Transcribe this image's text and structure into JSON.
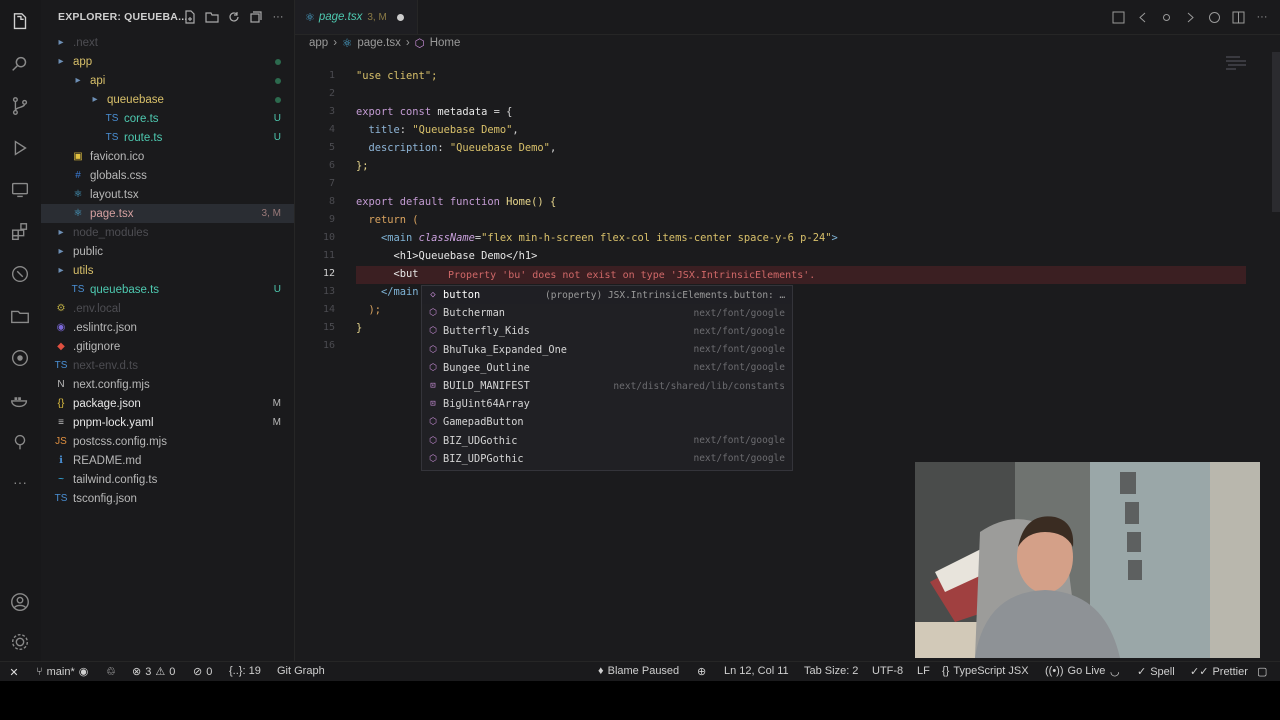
{
  "explorer": {
    "title": "EXPLORER: QUEUEBA...",
    "items": [
      {
        "label": ".next",
        "type": "folder",
        "status": ""
      },
      {
        "label": "app",
        "type": "folder",
        "status": ""
      },
      {
        "label": "api",
        "type": "folder",
        "status": ""
      },
      {
        "label": "queuebase",
        "type": "folder",
        "status": ""
      },
      {
        "label": "core.ts",
        "type": "ts",
        "status": "U"
      },
      {
        "label": "route.ts",
        "type": "ts",
        "status": "U"
      },
      {
        "label": "favicon.ico",
        "type": "ico",
        "status": ""
      },
      {
        "label": "globals.css",
        "type": "css",
        "status": ""
      },
      {
        "label": "layout.tsx",
        "type": "tsx",
        "status": ""
      },
      {
        "label": "page.tsx",
        "type": "tsx",
        "status": "3, M"
      },
      {
        "label": "node_modules",
        "type": "folder",
        "status": ""
      },
      {
        "label": "public",
        "type": "folder",
        "status": ""
      },
      {
        "label": "utils",
        "type": "folder",
        "status": ""
      },
      {
        "label": "queuebase.ts",
        "type": "ts",
        "status": "U"
      },
      {
        "label": ".env.local",
        "type": "env",
        "status": ""
      },
      {
        "label": ".eslintrc.json",
        "type": "eslint",
        "status": ""
      },
      {
        "label": ".gitignore",
        "type": "git",
        "status": ""
      },
      {
        "label": "next-env.d.ts",
        "type": "ts",
        "status": ""
      },
      {
        "label": "next.config.mjs",
        "type": "next",
        "status": ""
      },
      {
        "label": "package.json",
        "type": "json",
        "status": "M"
      },
      {
        "label": "pnpm-lock.yaml",
        "type": "yaml",
        "status": "M"
      },
      {
        "label": "postcss.config.mjs",
        "type": "js",
        "status": ""
      },
      {
        "label": "README.md",
        "type": "md",
        "status": ""
      },
      {
        "label": "tailwind.config.ts",
        "type": "tw",
        "status": ""
      },
      {
        "label": "tsconfig.json",
        "type": "tsjson",
        "status": ""
      }
    ]
  },
  "tab": {
    "name": "page.tsx",
    "status": "3, M"
  },
  "breadcrumb": [
    "app",
    "page.tsx",
    "Home"
  ],
  "editor": {
    "line_numbers": [
      "1",
      "2",
      "3",
      "4",
      "5",
      "6",
      "7",
      "8",
      "9",
      "10",
      "11",
      "12",
      "13",
      "14",
      "15",
      "16"
    ],
    "current_line": "12",
    "lines": {
      "l1": "\"use client\";",
      "l3_kw": "export const ",
      "l3_name": "metadata",
      "l3_rest": " = {",
      "l4_prop": "  title",
      "l4_str": "\"Queuebase Demo\"",
      "l5_prop": "  description",
      "l5_str": "\"Queuebase Demo\"",
      "l6": "};",
      "l8_kw": "export default function ",
      "l8_fn": "Home",
      "l8_rest": "() {",
      "l9": "  return (",
      "l10_open": "    <main ",
      "l10_attr": "className",
      "l10_val": "\"flex min-h-screen flex-col items-center space-y-6 p-24\"",
      "l10_close": ">",
      "l11": "      <h1>Queuebase Demo</h1>",
      "l12": "      <but",
      "l13": "    </main",
      "l14": "  );",
      "l15": "}"
    },
    "error_message": "Property 'bu' does not exist on type 'JSX.IntrinsicElements'."
  },
  "suggestions": [
    {
      "label": "button",
      "detail": "(property) JSX.IntrinsicElements.button: …",
      "icon": "property"
    },
    {
      "label": "Butcherman",
      "detail": "next/font/google",
      "icon": "module"
    },
    {
      "label": "Butterfly_Kids",
      "detail": "next/font/google",
      "icon": "module"
    },
    {
      "label": "BhuTuka_Expanded_One",
      "detail": "next/font/google",
      "icon": "module"
    },
    {
      "label": "Bungee_Outline",
      "detail": "next/font/google",
      "icon": "module"
    },
    {
      "label": "BUILD_MANIFEST",
      "detail": "next/dist/shared/lib/constants",
      "icon": "variable"
    },
    {
      "label": "BigUint64Array",
      "detail": "",
      "icon": "variable"
    },
    {
      "label": "GamepadButton",
      "detail": "",
      "icon": "module"
    },
    {
      "label": "BIZ_UDGothic",
      "detail": "next/font/google",
      "icon": "module"
    },
    {
      "label": "BIZ_UDPGothic",
      "detail": "next/font/google",
      "icon": "module"
    }
  ],
  "statusbar": {
    "branch": "main*",
    "errors": "3",
    "warnings_a": "0",
    "warnings_b": "0",
    "symbols": "{..}: 19",
    "git_graph": "Git Graph",
    "blame": "Blame Paused",
    "position": "Ln 12, Col 11",
    "tab_size": "Tab Size: 2",
    "encoding": "UTF-8",
    "eol": "LF",
    "language": "TypeScript JSX",
    "go_live": "Go Live",
    "spell": "Spell",
    "prettier": "Prettier"
  },
  "colors": {
    "untracked": "#4ec9b0",
    "modified": "#d8c06a",
    "error": "#d06868"
  }
}
